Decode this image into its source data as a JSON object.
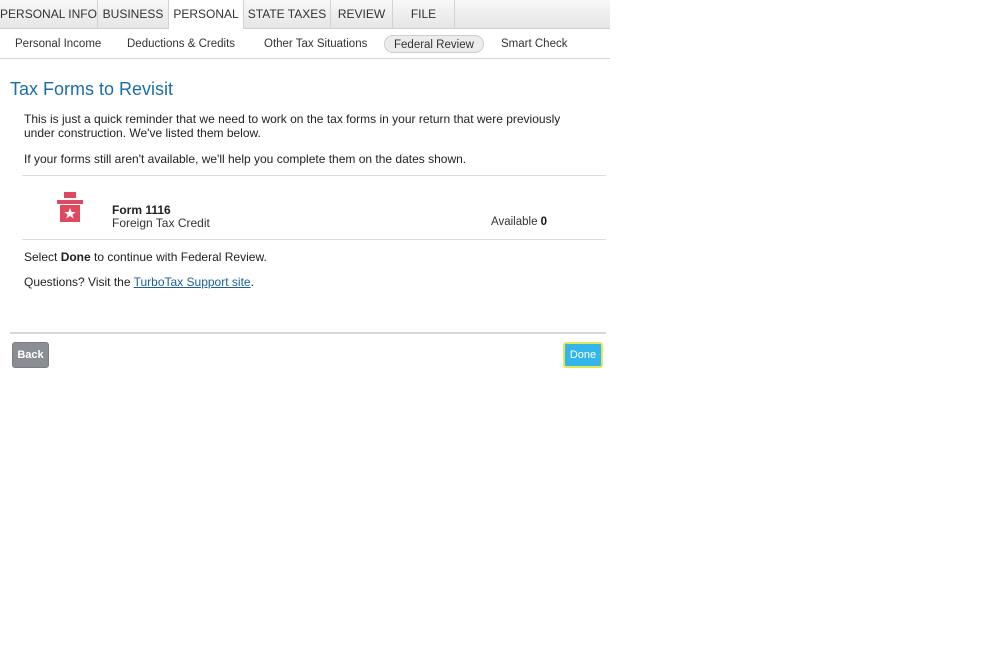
{
  "top_tabs": [
    {
      "label": "PERSONAL INFO"
    },
    {
      "label": "BUSINESS"
    },
    {
      "label": "PERSONAL",
      "active": true
    },
    {
      "label": "STATE TAXES"
    },
    {
      "label": "REVIEW"
    },
    {
      "label": "FILE"
    }
  ],
  "sub_nav": [
    {
      "label": "Personal Income"
    },
    {
      "label": "Deductions & Credits"
    },
    {
      "label": "Other Tax Situations"
    },
    {
      "label": "Federal Review",
      "active": true
    },
    {
      "label": "Smart Check"
    }
  ],
  "page": {
    "title": "Tax Forms to Revisit",
    "intro": "This is just a quick reminder that we need to work on the tax forms in your return that were previously under construction. We've listed them below.",
    "note": "If your forms still aren't available, we'll help you complete them on the dates shown."
  },
  "forms": [
    {
      "name": "Form 1116",
      "description": "Foreign Tax Credit",
      "available_label": "Available",
      "available_value": "0",
      "icon": "construction-box-icon"
    }
  ],
  "instructions": {
    "prefix": "Select ",
    "bold": "Done",
    "suffix": " to continue with Federal Review."
  },
  "questions": {
    "prefix": "Questions? Visit the ",
    "link_text": "TurboTax Support site",
    "suffix": "."
  },
  "buttons": {
    "back": "Back",
    "done": "Done"
  },
  "colors": {
    "title": "#1a6fa8",
    "done_button": "#35b6ea",
    "back_button": "#8a8d91",
    "icon": "#e0485f"
  }
}
